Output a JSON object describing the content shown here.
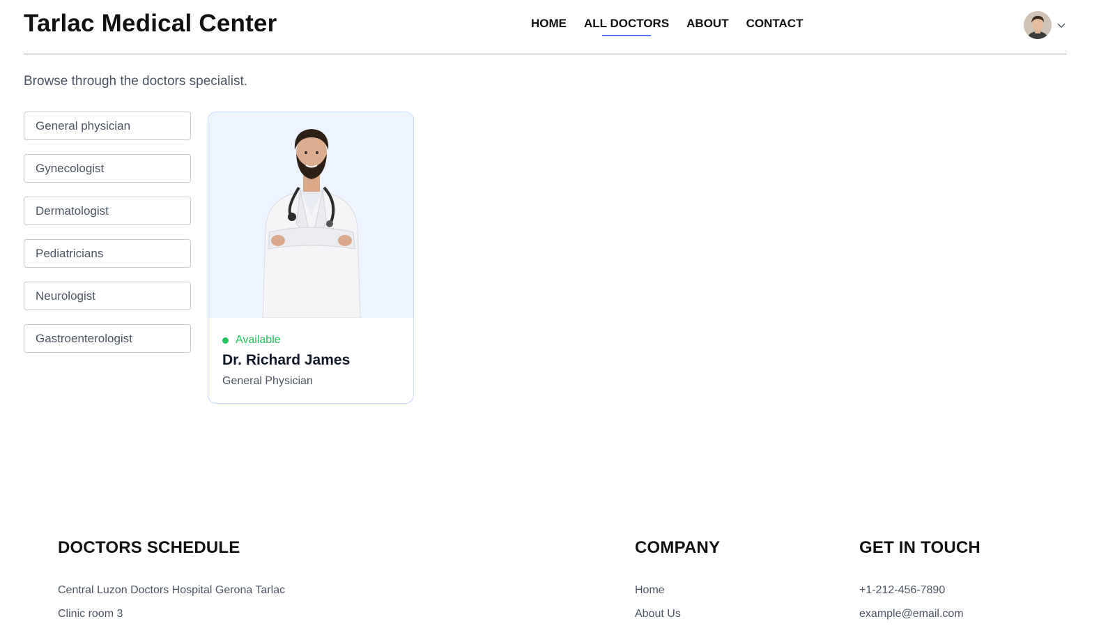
{
  "header": {
    "brand": "Tarlac Medical Center",
    "nav": [
      {
        "label": "HOME"
      },
      {
        "label": "ALL DOCTORS"
      },
      {
        "label": "ABOUT"
      },
      {
        "label": "CONTACT"
      }
    ],
    "active_nav": "ALL DOCTORS"
  },
  "intro": "Browse through the doctors specialist.",
  "specialities": [
    "General physician",
    "Gynecologist",
    "Dermatologist",
    "Pediatricians",
    "Neurologist",
    "Gastroenterologist"
  ],
  "doctor_card": {
    "status": "Available",
    "name": "Dr. Richard James",
    "speciality": "General Physician"
  },
  "footer": {
    "schedule": {
      "title": "DOCTORS SCHEDULE",
      "lines": [
        "Central Luzon Doctors Hospital Gerona Tarlac",
        "Clinic room 3"
      ]
    },
    "company": {
      "title": "COMPANY",
      "links": [
        "Home",
        "About Us"
      ]
    },
    "contact": {
      "title": "GET IN TOUCH",
      "lines": [
        "+1-212-456-7890",
        "example@email.com"
      ]
    }
  },
  "colors": {
    "accent": "#5f6fff",
    "available": "#22c55e",
    "card_bg": "#eef4ff",
    "card_border": "#c7dbff"
  },
  "icons": {
    "profile": "avatar-photo",
    "dropdown": "chevron-down-icon",
    "status": "green-dot-icon"
  }
}
